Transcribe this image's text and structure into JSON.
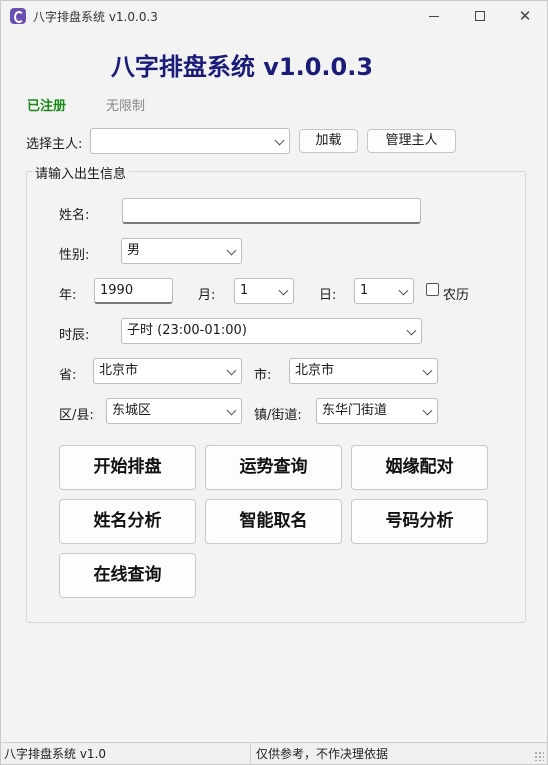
{
  "window": {
    "title": "八字排盘系统 v1.0.0.3"
  },
  "header": {
    "title": "八字排盘系统 v1.0.0.3",
    "registration": "已注册",
    "limit": "无限制"
  },
  "owner": {
    "label": "选择主人:",
    "value": "",
    "load_button": "加载",
    "manage_button": "管理主人"
  },
  "birth": {
    "group_title": "请输入出生信息",
    "name_label": "姓名:",
    "name_value": "",
    "gender_label": "性别:",
    "gender_value": "男",
    "year_label": "年:",
    "year_value": "1990",
    "month_label": "月:",
    "month_value": "1",
    "day_label": "日:",
    "day_value": "1",
    "lunar_label": "农历",
    "lunar_checked": false,
    "hour_label": "时辰:",
    "hour_value": "子时 (23:00-01:00)",
    "province_label": "省:",
    "province_value": "北京市",
    "city_label": "市:",
    "city_value": "北京市",
    "district_label": "区/县:",
    "district_value": "东城区",
    "street_label": "镇/街道:",
    "street_value": "东华门街道"
  },
  "actions": {
    "start": "开始排盘",
    "fortune": "运势查询",
    "match": "姻缘配对",
    "name_analysis": "姓名分析",
    "naming": "智能取名",
    "number_analysis": "号码分析",
    "online": "在线查询"
  },
  "status": {
    "left": "八字排盘系统 v1.0",
    "right": "仅供参考，不作决理依据"
  },
  "colors": {
    "title": "#1b1b7a",
    "registered": "#1a8a1a",
    "limit": "#888888"
  }
}
